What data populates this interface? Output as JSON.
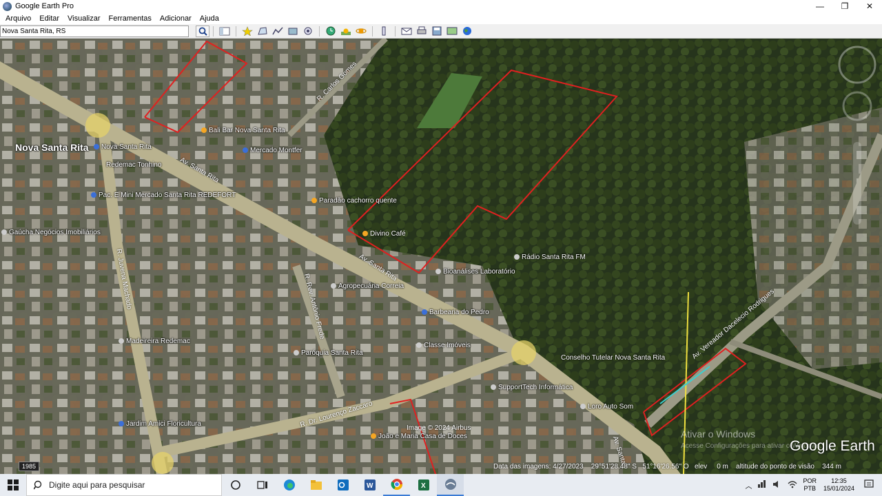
{
  "window": {
    "title": "Google Earth Pro",
    "minimize": "—",
    "maximize": "❐",
    "close": "✕"
  },
  "menu": [
    "Arquivo",
    "Editar",
    "Visualizar",
    "Ferramentas",
    "Adicionar",
    "Ajuda"
  ],
  "search": {
    "value": "Nova Santa Rita, RS"
  },
  "toolbar": {
    "icons": [
      "sidebar-toggle-icon",
      "placemark-icon",
      "polygon-icon",
      "path-icon",
      "image-overlay-icon",
      "record-tour-icon",
      "historical-imagery-icon",
      "sunlight-icon",
      "planets-icon",
      "ruler-icon",
      "email-icon",
      "print-icon",
      "save-image-icon",
      "view-in-maps-icon",
      "earth-icon"
    ]
  },
  "map": {
    "labels": [
      {
        "text": "Nova Santa Rita",
        "big": true,
        "pin": ""
      },
      {
        "text": "Nova Santa Rita",
        "pin": "#3b6fd8"
      },
      {
        "text": "Bali Bar Nova Santa Rita",
        "pin": "#f5a623"
      },
      {
        "text": "Mercado Montfer",
        "pin": "#3b6fd8"
      },
      {
        "text": "Redemac Tonhino",
        "pin": "#3b6fd8"
      },
      {
        "text": "Pac. E Mini Mercado Santa Rita REDEFORT",
        "pin": "#3b6fd8"
      },
      {
        "text": "Gaúcha Negócios Imobiliários",
        "pin": "#cccccc"
      },
      {
        "text": "Paradão cachorro quente",
        "pin": "#f5a623"
      },
      {
        "text": "Divino Café",
        "pin": "#f5a623"
      },
      {
        "text": "Bioanálises Laboratório",
        "pin": "#cccccc"
      },
      {
        "text": "Rádio Santa Rita FM",
        "pin": "#cccccc"
      },
      {
        "text": "Agropecuária Correia",
        "pin": "#cccccc"
      },
      {
        "text": "Barbearia do Pedro",
        "pin": "#3b6fd8"
      },
      {
        "text": "Classe Imóveis",
        "pin": "#cccccc"
      },
      {
        "text": "Madeireira Redemac",
        "pin": "#cccccc"
      },
      {
        "text": "Paróquia Santa Rita",
        "pin": "#cccccc"
      },
      {
        "text": "SupportTech Informática",
        "pin": "#cccccc"
      },
      {
        "text": "Conselho Tutelar Nova Santa Rita",
        "pin": "#cccccc"
      },
      {
        "text": "Loro Auto Som",
        "pin": "#cccccc"
      },
      {
        "text": "Jardim Amici Floricultura",
        "pin": "#3b6fd8"
      },
      {
        "text": "João e Maria Casa de Doces",
        "pin": "#f5a623"
      }
    ],
    "streets": [
      "Av. Santa Rita",
      "Av. Santa Rita",
      "R. Juvena Machado",
      "R. Rev. Antônio Frede",
      "R. Dr. Lourenço Zaccaro",
      "Av. Vereador Dacelecio Rodrigues",
      "R. Carlos Gomes",
      "Av. Santa"
    ],
    "copyright": "Image © 2024 Airbus",
    "historical_year": "1985",
    "status": {
      "image_date": "Data das imagens: 4/27/2023",
      "lat": "29°51'28.48\" S",
      "lon": "51°16'26.56\" O",
      "elev": "elev",
      "elev_value": "0 m",
      "eye_alt": "altitude do ponto de visão",
      "eye_alt_value": "344 m"
    },
    "brand": "Google Earth",
    "watermark_title": "Ativar o Windows",
    "watermark_sub": "Acesse Configurações para ativar o Windows."
  },
  "taskbar": {
    "search_placeholder": "Digite aqui para pesquisar",
    "apps": [
      "cortana-icon",
      "task-view-icon",
      "edge-icon",
      "file-explorer-icon",
      "outlook-icon",
      "word-icon",
      "chrome-icon",
      "excel-icon",
      "google-earth-icon"
    ],
    "lang1": "POR",
    "lang2": "PTB",
    "time": "12:35",
    "date": "15/01/2024"
  }
}
